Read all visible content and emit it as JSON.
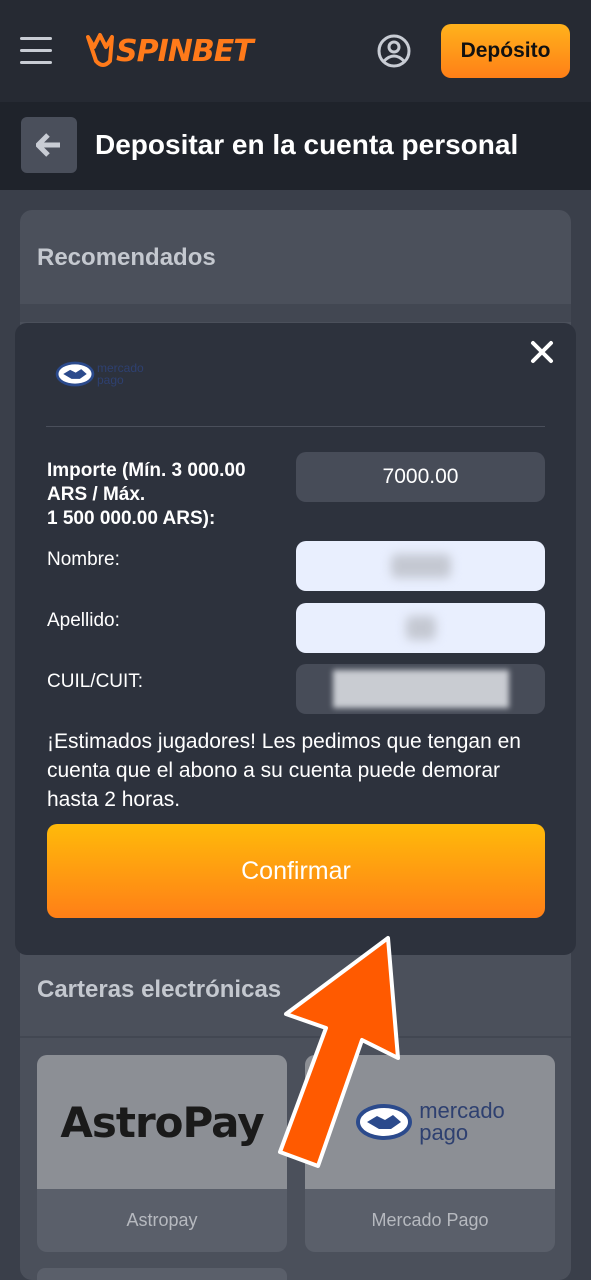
{
  "header": {
    "logo_text": "SPINBET",
    "deposit_label": "Depósito"
  },
  "titlebar": {
    "title": "Depositar en la cuenta personal"
  },
  "panel": {
    "recommended_heading": "Recomendados",
    "wallets_heading": "Carteras electrónicas",
    "wallets": [
      {
        "logo_text": "AstroPay",
        "label": "Astropay"
      },
      {
        "logo_text_line1": "mercado",
        "logo_text_line2": "pago",
        "label": "Mercado Pago"
      }
    ]
  },
  "modal": {
    "logo_line1": "mercado",
    "logo_line2": "pago",
    "amount_label_line1": "Importe (Mín. 3 000.00",
    "amount_label_line2": "ARS / Máx.",
    "amount_label_line3": "1 500 000.00 ARS):",
    "amount_value": "7000.00",
    "name_label": "Nombre:",
    "surname_label": "Apellido:",
    "cuil_label": "CUIL/CUIT:",
    "notice": "¡Estimados jugadores! Les pedimos que tengan en cuenta que el abono a su cuenta puede demorar hasta 2 horas.",
    "confirm_label": "Confirmar"
  },
  "colors": {
    "accent_orange": "#ff7f17",
    "accent_yellow": "#ffb21c",
    "arrow": "#ff5a00"
  }
}
